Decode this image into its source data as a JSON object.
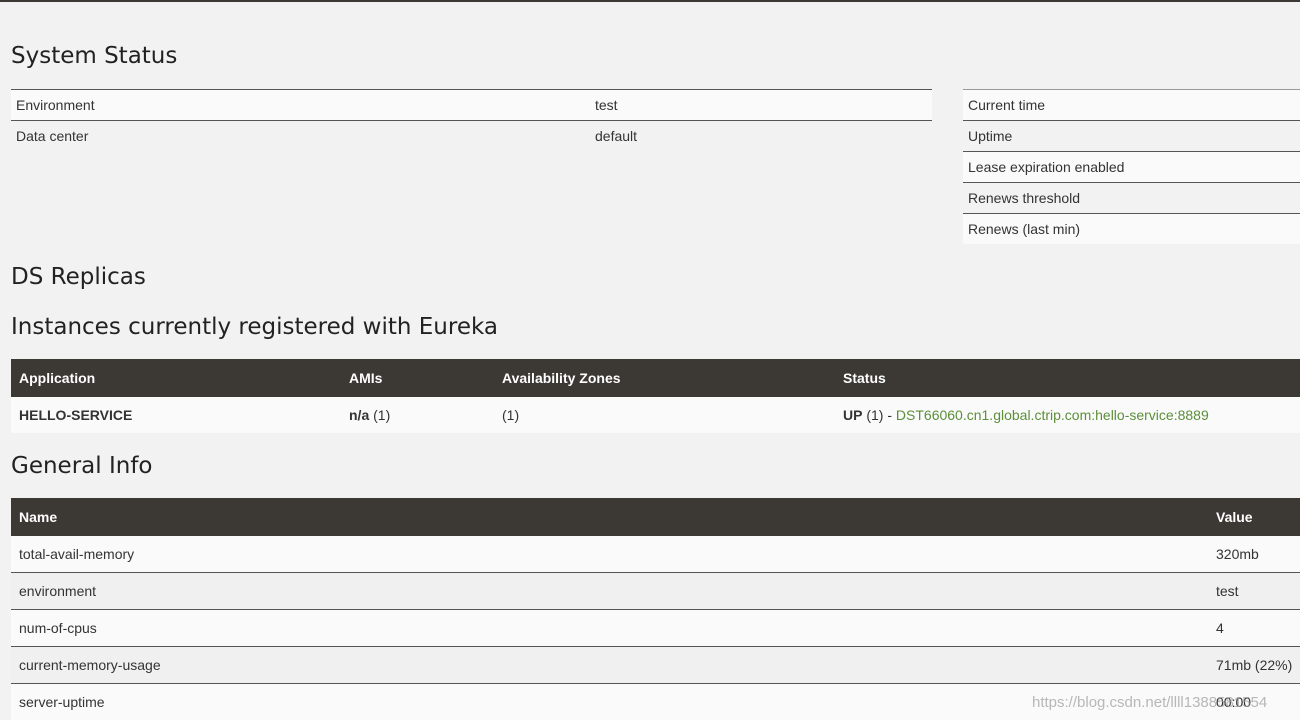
{
  "system_status": {
    "title": "System Status",
    "left_rows": [
      {
        "name": "Environment",
        "value": "test"
      },
      {
        "name": "Data center",
        "value": "default"
      }
    ],
    "right_rows": [
      {
        "name": "Current time"
      },
      {
        "name": "Uptime"
      },
      {
        "name": "Lease expiration enabled"
      },
      {
        "name": "Renews threshold"
      },
      {
        "name": "Renews (last min)"
      }
    ]
  },
  "ds_replicas": {
    "title": "DS Replicas"
  },
  "instances": {
    "title": "Instances currently registered with Eureka",
    "headers": {
      "application": "Application",
      "amis": "AMIs",
      "zones": "Availability Zones",
      "status": "Status"
    },
    "rows": [
      {
        "application": "HELLO-SERVICE",
        "ami_bold": "n/a",
        "ami_count": " (1)",
        "zones": "(1)",
        "status_bold": "UP",
        "status_count": " (1) - ",
        "instance_link": "DST66060.cn1.global.ctrip.com:hello-service:8889"
      }
    ]
  },
  "general_info": {
    "title": "General Info",
    "headers": {
      "name": "Name",
      "value": "Value"
    },
    "rows": [
      {
        "name": "total-avail-memory",
        "value": "320mb"
      },
      {
        "name": "environment",
        "value": "test"
      },
      {
        "name": "num-of-cpus",
        "value": "4"
      },
      {
        "name": "current-memory-usage",
        "value": "71mb (22%)"
      },
      {
        "name": "server-uptime",
        "value": "00:00"
      }
    ]
  },
  "watermark": "https://blog.csdn.net/llll1388581554",
  "colors": {
    "header_bg": "#3c3834",
    "link": "#5b8f3a",
    "page_bg": "#f2f2f2"
  }
}
